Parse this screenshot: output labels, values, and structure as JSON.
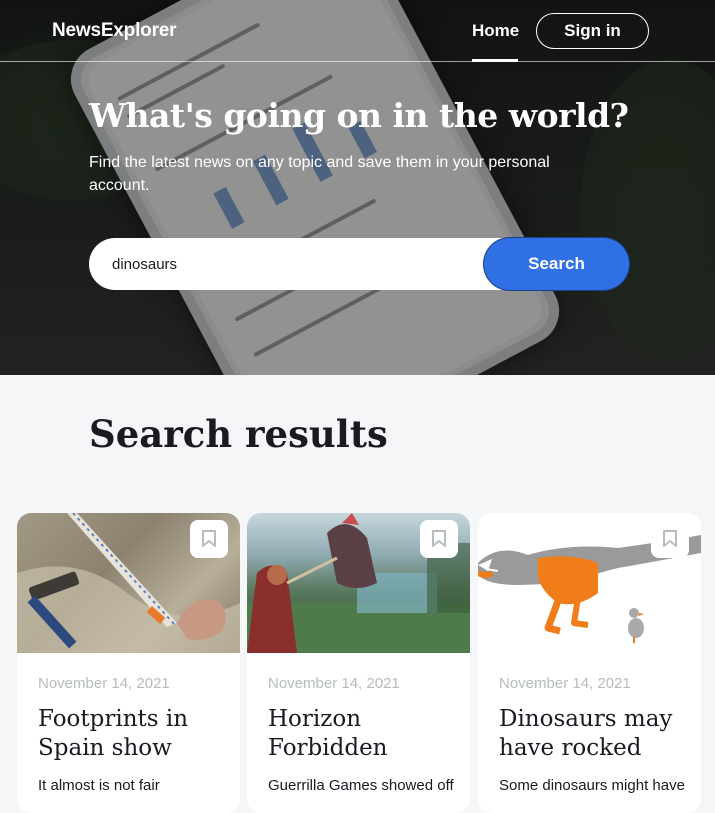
{
  "header": {
    "logo": "NewsExplorer",
    "nav_home": "Home",
    "nav_signin": "Sign in"
  },
  "hero": {
    "title": "What's going on in the world?",
    "subtitle": "Find the latest news on any topic and save them in your personal account.",
    "search_value": "dinosaurs",
    "search_button": "Search"
  },
  "results": {
    "title": "Search results",
    "cards": [
      {
        "date": "November 14, 2021",
        "title": "Footprints in Spain show",
        "text": "It almost is not fair",
        "image_icon": "hammer-fossil-image"
      },
      {
        "date": "November 14, 2021",
        "title": "Horizon Forbidden",
        "text": "Guerrilla Games showed off",
        "image_icon": "game-scene-image"
      },
      {
        "date": "November 14, 2021",
        "title": "Dinosaurs may have rocked",
        "text": "Some dinosaurs might have",
        "image_icon": "dinosaur-illustration-image"
      }
    ]
  },
  "colors": {
    "accent": "#2F71E5",
    "background": "#F5F6F7",
    "text": "#1A1B22",
    "date": "#B6BCBF"
  }
}
